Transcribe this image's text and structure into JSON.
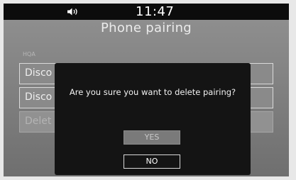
{
  "status_bar": {
    "volume_icon": "speaker-volume-icon",
    "time": "11:47"
  },
  "screen": {
    "title": "Phone pairing",
    "section_label": "HQA",
    "list_items": [
      "Disco",
      "Disco",
      "Delet"
    ]
  },
  "dialog": {
    "message": "Are you sure you want to delete pairing?",
    "yes_label": "YES",
    "no_label": "NO"
  }
}
